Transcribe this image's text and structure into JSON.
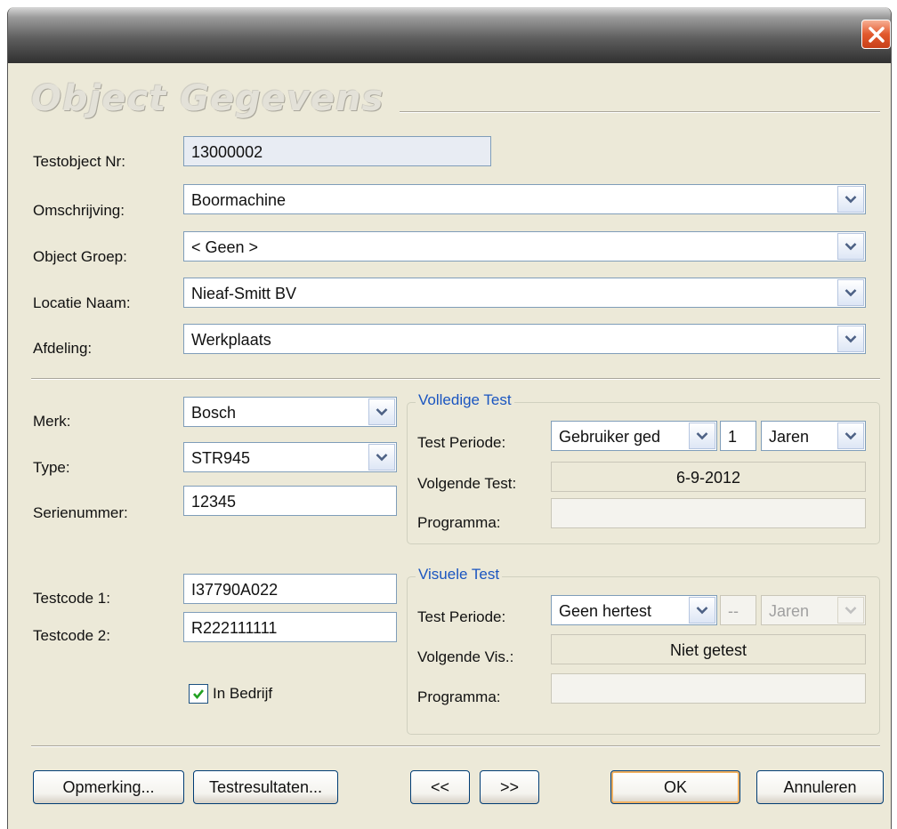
{
  "window": {
    "title": ""
  },
  "heading": "Object Gegevens",
  "form": {
    "testobject_nr": {
      "label": "Testobject Nr:",
      "value": "13000002"
    },
    "omschrijving": {
      "label": "Omschrijving:",
      "value": "Boormachine"
    },
    "object_groep": {
      "label": "Object Groep:",
      "value": "< Geen >"
    },
    "locatie_naam": {
      "label": "Locatie Naam:",
      "value": "Nieaf-Smitt BV"
    },
    "afdeling": {
      "label": "Afdeling:",
      "value": "Werkplaats"
    },
    "merk": {
      "label": "Merk:",
      "value": "Bosch"
    },
    "type": {
      "label": "Type:",
      "value": "STR945"
    },
    "serienummer": {
      "label": "Serienummer:",
      "value": "12345"
    },
    "testcode1": {
      "label": "Testcode 1:",
      "value": "I37790A022"
    },
    "testcode2": {
      "label": "Testcode 2:",
      "value": "R222111111"
    },
    "in_bedrijf": {
      "label": "In Bedrijf",
      "checked": true
    }
  },
  "volledige_test": {
    "title": "Volledige Test",
    "periode_label": "Test Periode:",
    "periode_type": "Gebruiker ged",
    "periode_count": "1",
    "periode_unit": "Jaren",
    "volgende_label": "Volgende Test:",
    "volgende_value": "6-9-2012",
    "programma_label": "Programma:",
    "programma_value": ""
  },
  "visuele_test": {
    "title": "Visuele Test",
    "periode_label": "Test Periode:",
    "periode_type": "Geen hertest",
    "periode_count": "--",
    "periode_unit": "Jaren",
    "volgende_label": "Volgende Vis.:",
    "volgende_value": "Niet getest",
    "programma_label": "Programma:",
    "programma_value": ""
  },
  "buttons": {
    "opmerking": "Opmerking...",
    "testresultaten": "Testresultaten...",
    "prev": "<<",
    "next": ">>",
    "ok": "OK",
    "annuleren": "Annuleren"
  },
  "icons": {
    "close": "close-icon",
    "dropdown": "chevron-down-icon",
    "check": "checkmark-icon"
  },
  "colors": {
    "close_button": "#e2592d",
    "group_title": "#1a55c0",
    "dialog_bg": "#ECE9D8"
  }
}
